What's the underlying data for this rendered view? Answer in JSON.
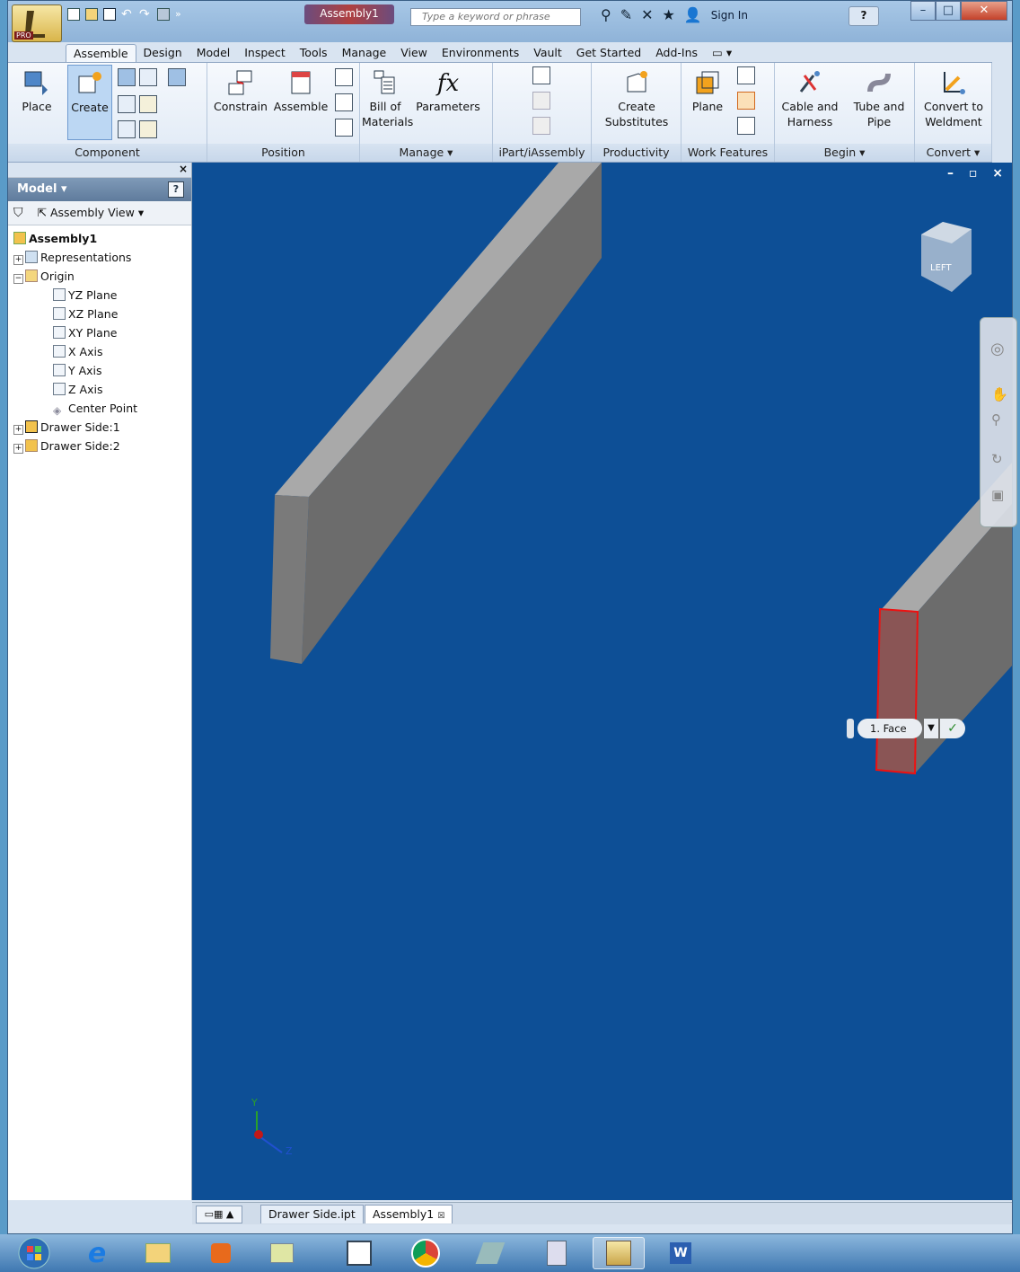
{
  "window": {
    "doc_title": "Assembly1",
    "search_placeholder": "Type a keyword or phrase",
    "sign_in": "Sign In",
    "help": "?",
    "app_badge": "PRO"
  },
  "tabs": [
    "Assemble",
    "Design",
    "Model",
    "Inspect",
    "Tools",
    "Manage",
    "View",
    "Environments",
    "Vault",
    "Get Started",
    "Add-Ins"
  ],
  "active_tab": "Assemble",
  "ribbon": {
    "component": {
      "label": "Component",
      "place": "Place",
      "create": "Create"
    },
    "position": {
      "label": "Position",
      "constrain": "Constrain",
      "assemble": "Assemble"
    },
    "manage": {
      "label": "Manage ▾",
      "bom1": "Bill of",
      "bom2": "Materials",
      "parameters": "Parameters",
      "fx": "fx"
    },
    "ipart": {
      "label": "iPart/iAssembly"
    },
    "productivity": {
      "label": "Productivity",
      "cs1": "Create",
      "cs2": "Substitutes"
    },
    "workfeatures": {
      "label": "Work Features",
      "plane": "Plane"
    },
    "begin": {
      "label": "Begin ▾",
      "cable1": "Cable and",
      "cable2": "Harness",
      "tube1": "Tube and",
      "tube2": "Pipe"
    },
    "convert": {
      "label": "Convert ▾",
      "w1": "Convert to",
      "w2": "Weldment"
    }
  },
  "browser": {
    "title": "Model ▾",
    "view": "Assembly View",
    "help": "?",
    "tree": {
      "root": "Assembly1",
      "representations": "Representations",
      "origin": "Origin",
      "yz": "YZ Plane",
      "xz": "XZ Plane",
      "xy": "XY Plane",
      "xaxis": "X Axis",
      "yaxis": "Y Axis",
      "zaxis": "Z Axis",
      "center": "Center Point",
      "ds1": "Drawer Side:1",
      "ds2": "Drawer Side:2"
    }
  },
  "viewport": {
    "viewcube_label": "LEFT",
    "face_pill": "1. Face",
    "triad": {
      "y": "Y",
      "z": "Z"
    }
  },
  "doc_tabs": [
    "Drawer Side.ipt",
    "Assembly1"
  ],
  "colors": {
    "viewport_bg": "#0d4f96",
    "selection": "#cc1f1f"
  }
}
